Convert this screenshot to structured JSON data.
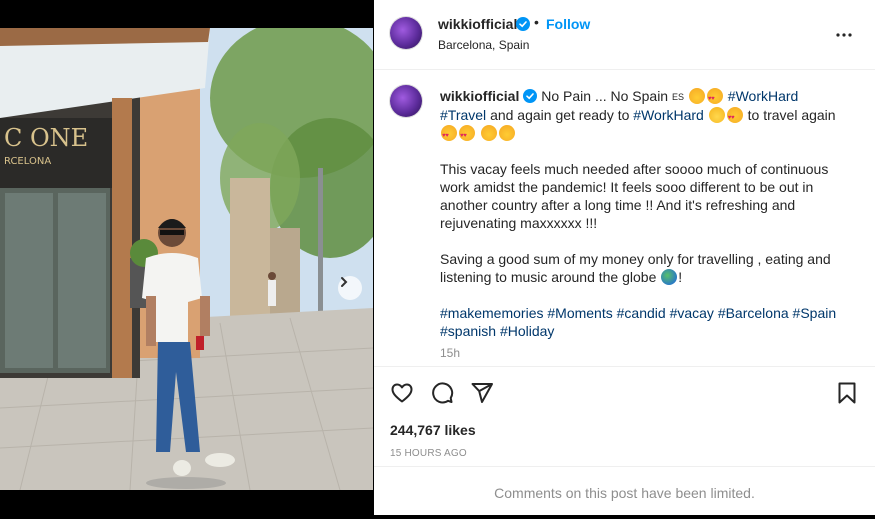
{
  "post": {
    "username": "wikkiofficial",
    "follow_label": "Follow",
    "separator": "•",
    "location": "Barcelona, Spain",
    "photo_description_icon": "photo",
    "carousel": {
      "slides": 4,
      "current": 1
    }
  },
  "caption": {
    "username": "wikkiofficial",
    "line1_a": "No Pain ... No Spain",
    "flag_code": "ES",
    "tag_workhard": "#WorkHard",
    "tag_travel": "#Travel",
    "line2_a": "and again get ready to",
    "tag_workhard2": "#WorkHard",
    "line2_b": "to travel again",
    "para2": "This vacay feels much needed after soooo much of continuous work amidst the pandemic! It feels sooo different to be out in another country after a long time !! And it's refreshing and rejuvenating maxxxxxx !!!",
    "para3_a": "Saving a good sum of my money only for travelling , eating and listening to music around the globe",
    "para3_b": "!",
    "hashtags": [
      "#makememories",
      "#Moments",
      "#candid",
      "#vacay",
      "#Barcelona",
      "#Spain",
      "#spanish",
      "#Holiday"
    ],
    "time": "15h"
  },
  "actions": {
    "likes": "244,767 likes",
    "posted_ago": "15 HOURS AGO"
  },
  "comments": {
    "limited_text": "Comments on this post have been limited."
  },
  "colors": {
    "link": "#0095f6",
    "hashtag": "#00376b",
    "muted": "#8e8e8e"
  }
}
